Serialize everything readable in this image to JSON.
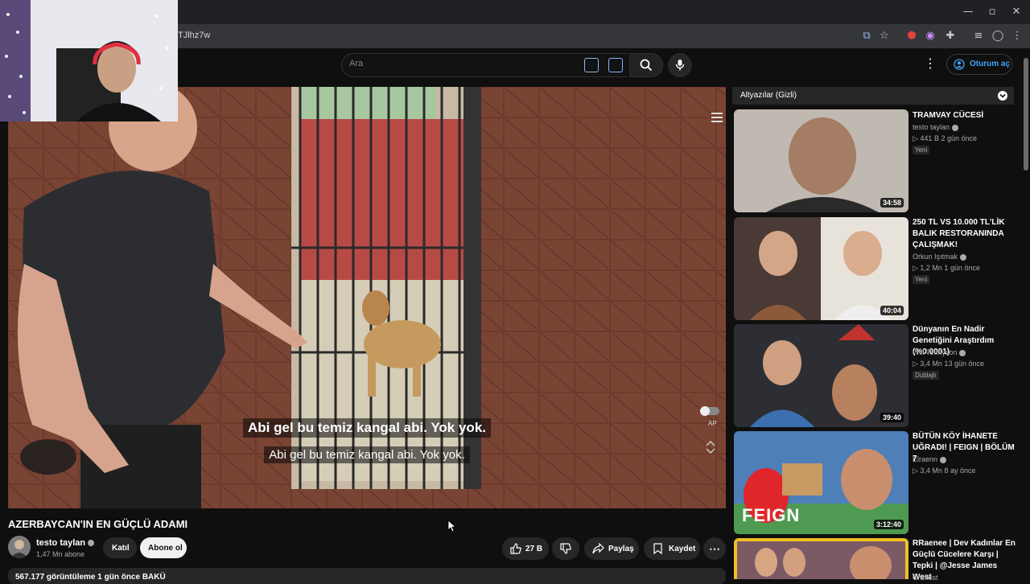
{
  "browser": {
    "url_fragment": "TJlhz7w",
    "window_controls": [
      "minimize",
      "maximize",
      "close"
    ]
  },
  "header": {
    "search_placeholder": "Ara",
    "signin_label": "Oturum aç"
  },
  "video": {
    "subtitle_bold": "Abi gel bu temiz kangal abi. Yok yok.",
    "subtitle_plain": "Abi gel bu temiz kangal abi. Yok yok.",
    "autoplay_label": "AP",
    "title": "AZERBAYCAN'IN EN GÜÇLÜ ADAMI",
    "channel": "testo taylan",
    "subscribers": "1,47 Mn abone",
    "join_label": "Katıl",
    "subscribe_label": "Abone ol",
    "likes": "27 B",
    "share_label": "Paylaş",
    "save_label": "Kaydet",
    "views_line": "567.177 görüntüleme  1 gün önce  BAKÜ"
  },
  "sidebar": {
    "captions_label": "Altyazılar (Gizli)",
    "items": [
      {
        "title": "TRAMVAY CÜCESİ",
        "channel": "testo taylan",
        "meta": "▷ 441 B   2 gün önce",
        "badge": "Yeni",
        "duration": "34:58"
      },
      {
        "title": "250 TL VS 10.000 TL'LİK BALIK RESTORANINDA ÇALIŞMAK!",
        "channel": "Orkun Işıtmak",
        "meta": "▷ 1,2 Mn   1 gün önce",
        "badge": "Yeni",
        "duration": "40:04"
      },
      {
        "title": "Dünyanın En Nadir Genetiğini Araştırdım (%0.0001)",
        "channel": "Will Tennyson",
        "meta": "▷ 3,4 Mn   13 gün önce",
        "badge": "Dublajlı",
        "duration": "39:40"
      },
      {
        "title": "BÜTÜN KÖY İHANETE UĞRADI! | FEIGN | BÖLÜM 7",
        "channel": "Elraenn",
        "meta": "▷ 3,4 Mn   8 ay önce",
        "badge": "",
        "duration": "3:12:40"
      },
      {
        "title": "RRaenee | Dev Kadınlar En Güçlü Cücelere Karşı | Tepki | @Jesse James West",
        "channel": "Craftest",
        "meta": "",
        "badge": "",
        "duration": ""
      }
    ],
    "feign_text": "FEIGN"
  },
  "colors": {
    "background": "#0f0f0f",
    "accent_blue": "#3ea6ff",
    "pill": "#272727"
  }
}
